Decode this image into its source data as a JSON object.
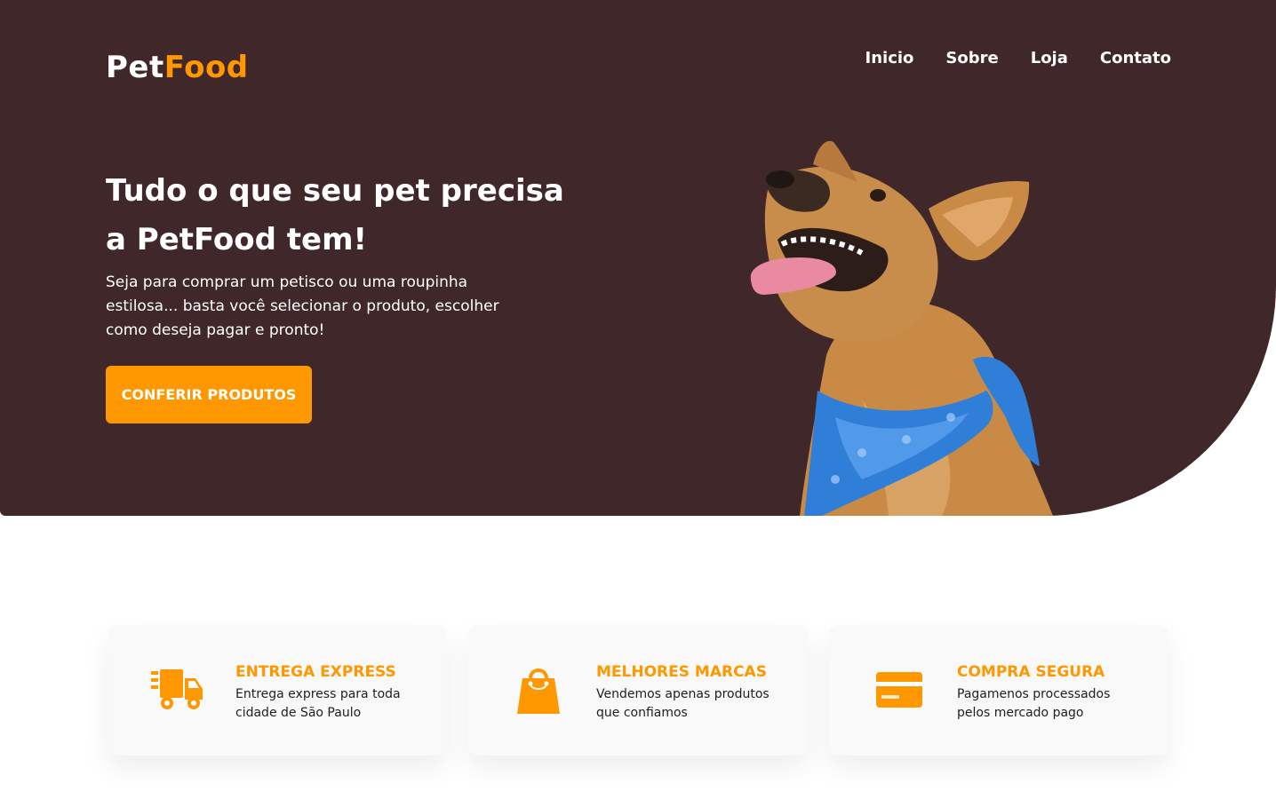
{
  "brand": {
    "name_part1": "Pet",
    "name_part2": "Food"
  },
  "nav": {
    "items": [
      "Inicio",
      "Sobre",
      "Loja",
      "Contato"
    ]
  },
  "hero": {
    "title_line1": "Tudo o que seu pet precisa",
    "title_line2": "a PetFood tem!",
    "description": "Seja para comprar um petisco ou uma roupinha estilosa... basta você selecionar o produto, escolher como deseja pagar e pronto!",
    "cta_label": "CONFERIR PRODUTOS",
    "image": "dog-with-blue-bandana"
  },
  "features": [
    {
      "icon": "delivery-truck-icon",
      "title": "ENTREGA EXPRESS",
      "text": "Entrega express para toda cidade de São Paulo"
    },
    {
      "icon": "shopping-bag-icon",
      "title": "MELHORES MARCAS",
      "text": "Vendemos apenas produtos que confiamos"
    },
    {
      "icon": "credit-card-icon",
      "title": "COMPRA SEGURA",
      "text": "Pagamenos processados pelos mercado pago"
    }
  ],
  "colors": {
    "hero_bg": "#40282a",
    "accent": "#ff9800",
    "card_bg": "#f9f9f9",
    "text_dark": "#1e1e1e"
  }
}
